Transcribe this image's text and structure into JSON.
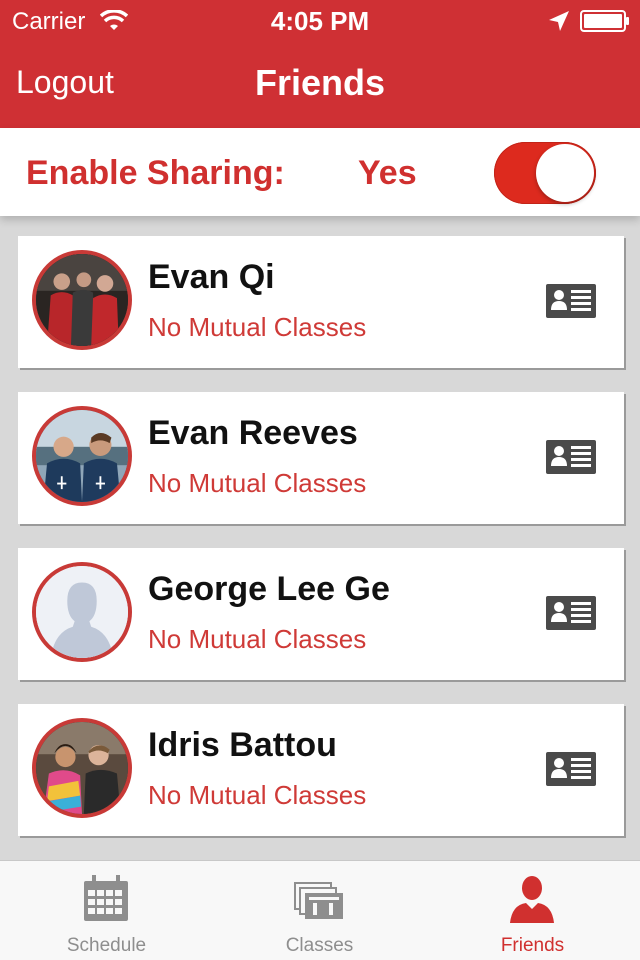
{
  "status_bar": {
    "carrier": "Carrier",
    "time": "4:05 PM"
  },
  "nav": {
    "logout_label": "Logout",
    "title": "Friends"
  },
  "sharing": {
    "label": "Enable Sharing:",
    "value": "Yes",
    "enabled": true,
    "toggle_color": "#dd2a1e"
  },
  "friends": [
    {
      "name": "Evan Qi",
      "subtitle": "No Mutual Classes",
      "avatar": "photo-group-red"
    },
    {
      "name": "Evan Reeves",
      "subtitle": "No Mutual Classes",
      "avatar": "photo-two-people"
    },
    {
      "name": "George Lee Ge",
      "subtitle": "No Mutual Classes",
      "avatar": "default-silhouette"
    },
    {
      "name": "Idris Battou",
      "subtitle": "No Mutual Classes",
      "avatar": "photo-two-people-colorful"
    }
  ],
  "tabs": [
    {
      "label": "Schedule",
      "icon": "calendar-icon",
      "active": false
    },
    {
      "label": "Classes",
      "icon": "classes-icon",
      "active": false
    },
    {
      "label": "Friends",
      "icon": "person-icon",
      "active": true
    }
  ],
  "colors": {
    "brand": "#cf3034",
    "accent_text": "#d0302f",
    "tab_inactive": "#8e8e8e"
  }
}
